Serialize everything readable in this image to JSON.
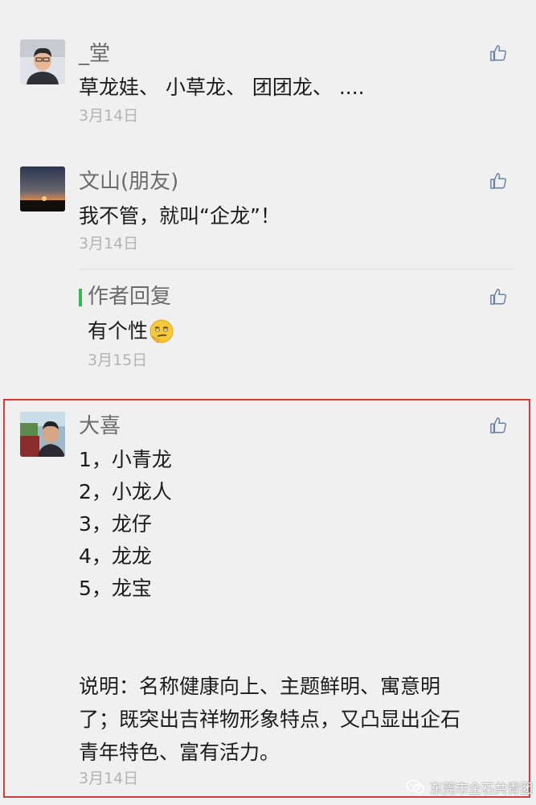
{
  "comments": [
    {
      "name": "_堂",
      "text": "草龙娃、 小草龙、 团团龙、 ....",
      "date": "3月14日"
    },
    {
      "name": "文山(朋友)",
      "text": "我不管，就叫“企龙”！",
      "date": "3月14日",
      "reply": {
        "label": "作者回复",
        "text": "有个性",
        "emoji": "smirk-emoji",
        "date": "3月15日"
      }
    },
    {
      "name": "大喜",
      "lines": [
        "1，小青龙",
        "2，小龙人",
        "3，龙仔",
        "4，龙龙",
        "5，龙宝"
      ],
      "explanation": [
        "说明：名称健康向上、主题鲜明、寓意明",
        "了；既突出吉祥物形象特点，又凸显出企石",
        "青年特色、富有活力。"
      ],
      "date": "3月14日"
    }
  ],
  "watermark": "东莞市企石共青团",
  "colors": {
    "background": "#f0f0f0",
    "highlight_border": "#d73a3a",
    "reply_bar": "#2fbb4f",
    "like_icon": "#6a7fa6"
  },
  "icons": {
    "like": "thumbs-up-icon"
  }
}
